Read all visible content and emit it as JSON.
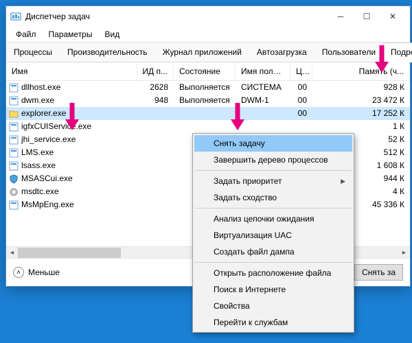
{
  "window": {
    "title": "Диспетчер задач"
  },
  "menu": {
    "file": "Файл",
    "options": "Параметры",
    "view": "Вид"
  },
  "tabs": {
    "t0": "Процессы",
    "t1": "Производительность",
    "t2": "Журнал приложений",
    "t3": "Автозагрузка",
    "t4": "Пользователи",
    "t5": "Подробности"
  },
  "cols": {
    "name": "Имя",
    "pid": "ИД п...",
    "state": "Состояние",
    "user": "Имя польз...",
    "cpu": "ЦП",
    "mem": "Память (ч..."
  },
  "rows": [
    {
      "name": "dllhost.exe",
      "pid": "2628",
      "state": "Выполняется",
      "user": "СИСТЕМА",
      "cpu": "00",
      "mem": "928 К"
    },
    {
      "name": "dwm.exe",
      "pid": "948",
      "state": "Выполняется",
      "user": "DWM-1",
      "cpu": "00",
      "mem": "23 472 К"
    },
    {
      "name": "explorer.exe",
      "pid": "",
      "state": "",
      "user": "",
      "cpu": "00",
      "mem": "17 252 К"
    },
    {
      "name": "igfxCUIService.exe",
      "pid": "",
      "state": "",
      "user": "",
      "cpu": "",
      "mem": "1 К"
    },
    {
      "name": "jhi_service.exe",
      "pid": "",
      "state": "",
      "user": "",
      "cpu": "",
      "mem": "52 К"
    },
    {
      "name": "LMS.exe",
      "pid": "",
      "state": "",
      "user": "",
      "cpu": "",
      "mem": "512 К"
    },
    {
      "name": "lsass.exe",
      "pid": "",
      "state": "",
      "user": "",
      "cpu": "",
      "mem": "1 608 К"
    },
    {
      "name": "MSASCui.exe",
      "pid": "",
      "state": "",
      "user": "",
      "cpu": "",
      "mem": "944 К"
    },
    {
      "name": "msdtc.exe",
      "pid": "",
      "state": "",
      "user": "",
      "cpu": "",
      "mem": "4 К"
    },
    {
      "name": "MsMpEng.exe",
      "pid": "",
      "state": "",
      "user": "",
      "cpu": "",
      "mem": "45 336 К"
    }
  ],
  "ctx": {
    "i0": "Снять задачу",
    "i1": "Завершить дерево процессов",
    "i2": "Задать приоритет",
    "i3": "Задать сходство",
    "i4": "Анализ цепочки ожидания",
    "i5": "Виртуализация UAC",
    "i6": "Создать файл дампа",
    "i7": "Открыть расположение файла",
    "i8": "Поиск в Интернете",
    "i9": "Свойства",
    "i10": "Перейти к службам"
  },
  "footer": {
    "fewer": "Меньше",
    "endtask": "Снять за"
  }
}
